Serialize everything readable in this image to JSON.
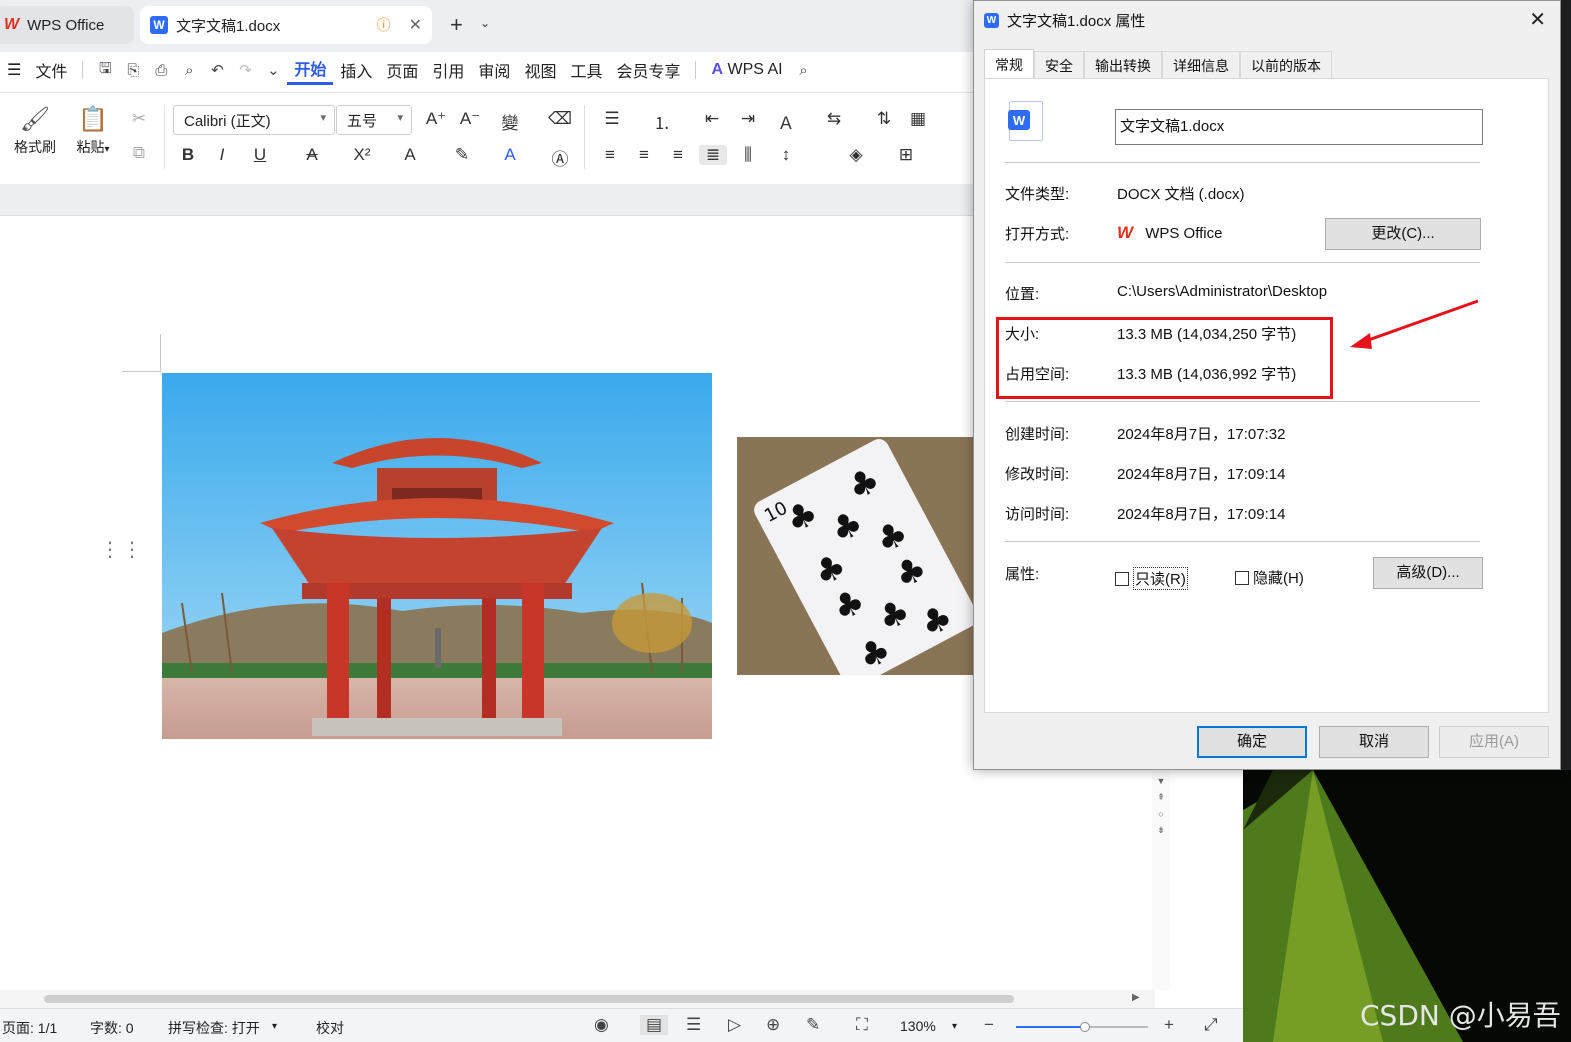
{
  "tabs": {
    "home_tab": "WPS Office",
    "doc_tab": "文字文稿1.docx"
  },
  "menu": {
    "file": "文件",
    "items": [
      "开始",
      "插入",
      "页面",
      "引用",
      "审阅",
      "视图",
      "工具",
      "会员专享"
    ],
    "ai": "WPS AI"
  },
  "ribbon": {
    "format_painter": "格式刷",
    "paste": "粘贴",
    "font_name": "Calibri (正文)",
    "font_size": "五号"
  },
  "status": {
    "page": "页面: 1/1",
    "words": "字数: 0",
    "spell": "拼写检查: 打开",
    "proof": "校对",
    "zoom": "130%",
    "zoom_fraction": 0.52
  },
  "dialog": {
    "title": "文字文稿1.docx 属性",
    "tabs": [
      "常规",
      "安全",
      "输出转换",
      "详细信息",
      "以前的版本"
    ],
    "filename": "文字文稿1.docx",
    "type_label": "文件类型:",
    "type_value": "DOCX 文档 (.docx)",
    "open_label": "打开方式:",
    "open_value": "WPS Office",
    "change_btn": "更改(C)...",
    "location_label": "位置:",
    "location_value": "C:\\Users\\Administrator\\Desktop",
    "size_label": "大小:",
    "size_value": "13.3 MB (14,034,250 字节)",
    "disk_label": "占用空间:",
    "disk_value": "13.3 MB (14,036,992 字节)",
    "created_label": "创建时间:",
    "created_value": "2024年8月7日，17:07:32",
    "modified_label": "修改时间:",
    "modified_value": "2024年8月7日，17:09:14",
    "accessed_label": "访问时间:",
    "accessed_value": "2024年8月7日，17:09:14",
    "attr_label": "属性:",
    "readonly": "只读(R)",
    "hidden": "隐藏(H)",
    "advanced_btn": "高级(D)...",
    "ok": "确定",
    "cancel": "取消",
    "apply": "应用(A)"
  },
  "watermark": "CSDN @小易吾",
  "colors": {
    "accent": "#2f5bea",
    "highlight": "#e5121b",
    "wps_red": "#e0301e"
  }
}
